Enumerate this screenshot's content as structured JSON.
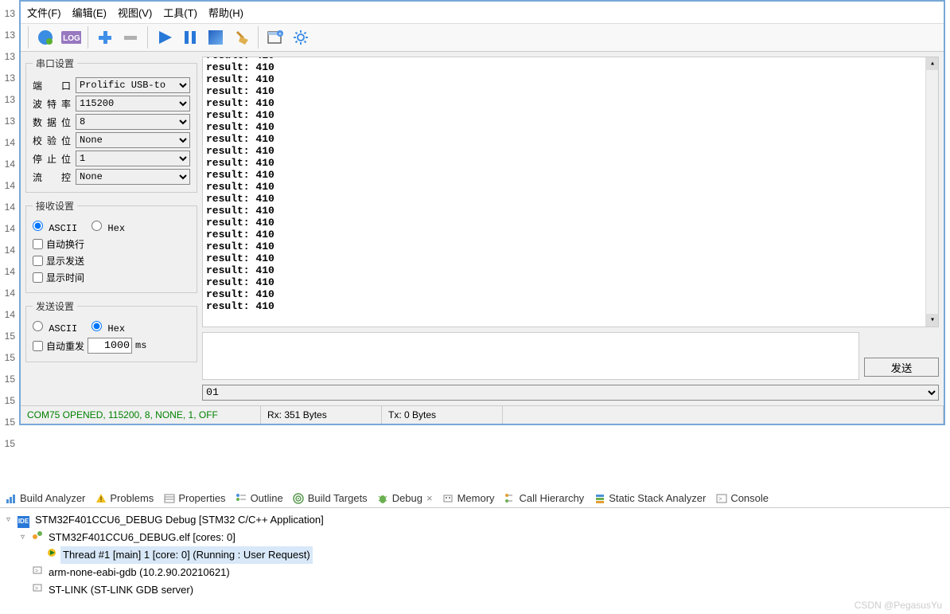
{
  "line_numbers": [
    "13",
    "13",
    "13",
    "13",
    "13",
    "13",
    "14",
    "14",
    "14",
    "14",
    "14",
    "14",
    "14",
    "14",
    "14",
    "15",
    "15",
    "15",
    "15",
    "15",
    "15"
  ],
  "menubar": [
    "文件(F)",
    "编辑(E)",
    "视图(V)",
    "工具(T)",
    "帮助(H)"
  ],
  "serial_settings": {
    "legend": "串口设置",
    "port_label": "端　口",
    "port_value": "Prolific USB-to",
    "baud_label": "波特率",
    "baud_value": "115200",
    "databits_label": "数据位",
    "databits_value": "8",
    "parity_label": "校验位",
    "parity_value": "None",
    "stopbits_label": "停止位",
    "stopbits_value": "1",
    "flow_label": "流　控",
    "flow_value": "None"
  },
  "recv_settings": {
    "legend": "接收设置",
    "ascii_label": "ASCII",
    "hex_label": "Hex",
    "ascii_selected": true,
    "auto_wrap": "自动换行",
    "show_send": "显示发送",
    "show_time": "显示时间"
  },
  "send_settings": {
    "legend": "发送设置",
    "ascii_label": "ASCII",
    "hex_label": "Hex",
    "hex_selected": true,
    "auto_resend": "自动重发",
    "resend_interval": "1000",
    "resend_unit": "ms"
  },
  "output_lines": [
    "result: 410",
    "result: 410",
    "result: 410",
    "result: 410",
    "result: 410",
    "result: 410",
    "result: 410",
    "result: 410",
    "result: 410",
    "result: 410",
    "result: 410",
    "result: 410",
    "result: 410",
    "result: 410",
    "result: 410",
    "result: 410",
    "result: 410",
    "result: 410",
    "result: 410",
    "result: 410",
    "result: 410",
    "result: 410"
  ],
  "send_button": "发送",
  "history_value": "01",
  "status": {
    "connection": "COM75 OPENED, 115200, 8, NONE, 1, OFF",
    "rx": "Rx: 351 Bytes",
    "tx": "Tx: 0 Bytes"
  },
  "ide_tabs": [
    {
      "icon": "analyzer",
      "label": "Build Analyzer"
    },
    {
      "icon": "problems",
      "label": "Problems"
    },
    {
      "icon": "properties",
      "label": "Properties"
    },
    {
      "icon": "outline",
      "label": "Outline"
    },
    {
      "icon": "targets",
      "label": "Build Targets"
    },
    {
      "icon": "debug",
      "label": "Debug",
      "close": true
    },
    {
      "icon": "memory",
      "label": "Memory"
    },
    {
      "icon": "callh",
      "label": "Call Hierarchy"
    },
    {
      "icon": "stack",
      "label": "Static Stack Analyzer"
    },
    {
      "icon": "console",
      "label": "Console"
    }
  ],
  "debug_tree": [
    {
      "level": 0,
      "icon": "ide",
      "text": "STM32F401CCU6_DEBUG Debug [STM32 C/C++ Application]",
      "twist": "▿"
    },
    {
      "level": 1,
      "icon": "app",
      "text": "STM32F401CCU6_DEBUG.elf [cores: 0]",
      "twist": "▿"
    },
    {
      "level": 2,
      "icon": "thread",
      "text": "Thread #1 [main] 1 [core: 0] (Running : User Request)",
      "selected": true
    },
    {
      "level": 1,
      "icon": "gdb",
      "text": "arm-none-eabi-gdb (10.2.90.20210621)"
    },
    {
      "level": 1,
      "icon": "stlink",
      "text": "ST-LINK (ST-LINK GDB server)"
    }
  ],
  "watermark": "CSDN @PegasusYu"
}
